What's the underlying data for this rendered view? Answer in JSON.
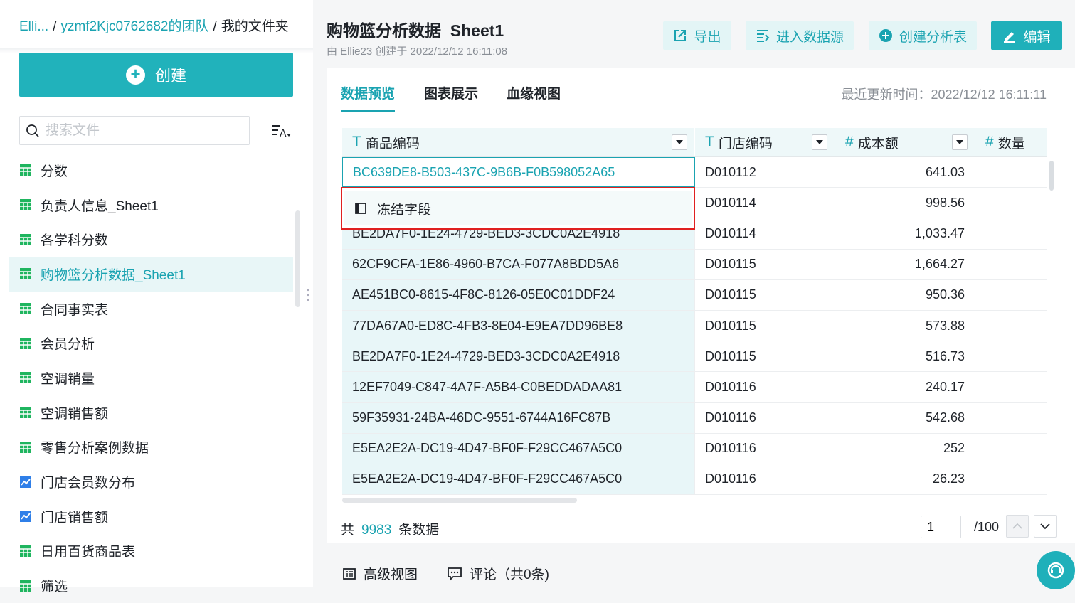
{
  "breadcrumb": {
    "item1": "Elli...",
    "item2": "yzmf2Kjc0762682的团队",
    "item3": "我的文件夹",
    "sep": "/"
  },
  "sidebar": {
    "create_label": "创建",
    "search_placeholder": "搜索文件",
    "files": [
      {
        "label": "分数",
        "icon": "table-icon",
        "active": false
      },
      {
        "label": "负责人信息_Sheet1",
        "icon": "table-icon",
        "active": false
      },
      {
        "label": "各学科分数",
        "icon": "table-icon",
        "active": false
      },
      {
        "label": "购物篮分析数据_Sheet1",
        "icon": "table-icon",
        "active": true
      },
      {
        "label": "合同事实表",
        "icon": "table-icon",
        "active": false
      },
      {
        "label": "会员分析",
        "icon": "table-icon",
        "active": false
      },
      {
        "label": "空调销量",
        "icon": "table-icon",
        "active": false
      },
      {
        "label": "空调销售额",
        "icon": "table-icon",
        "active": false
      },
      {
        "label": "零售分析案例数据",
        "icon": "table-icon",
        "active": false
      },
      {
        "label": "门店会员数分布",
        "icon": "chart-icon",
        "active": false
      },
      {
        "label": "门店销售额",
        "icon": "chart-icon",
        "active": false
      },
      {
        "label": "日用百货商品表",
        "icon": "table-icon",
        "active": false
      },
      {
        "label": "筛选",
        "icon": "table-icon",
        "active": false
      }
    ]
  },
  "header": {
    "title": "购物篮分析数据_Sheet1",
    "subtitle": "由 Ellie23 创建于 2022/12/12 16:11:08",
    "export_label": "导出",
    "datasource_label": "进入数据源",
    "create_analysis_label": "创建分析表",
    "edit_label": "编辑"
  },
  "tabs": {
    "preview": "数据预览",
    "chart": "图表展示",
    "lineage": "血缘视图",
    "updated": "最近更新时间：2022/12/12 16:11:11"
  },
  "table": {
    "columns": [
      {
        "type": "T",
        "name": "商品编码"
      },
      {
        "type": "T",
        "name": "门店编码"
      },
      {
        "type": "#",
        "name": "成本额"
      },
      {
        "type": "#",
        "name": "数量"
      }
    ],
    "rows": [
      [
        "BC639DE8-B503-437C-9B6B-F0B598052A65",
        "D010112",
        "641.03",
        ""
      ],
      [
        "",
        "D010114",
        "998.56",
        ""
      ],
      [
        "BE2DA7F0-1E24-4729-BED3-3CDC0A2E4918",
        "D010114",
        "1,033.47",
        ""
      ],
      [
        "62CF9CFA-1E86-4960-B7CA-F077A8BDD5A6",
        "D010115",
        "1,664.27",
        ""
      ],
      [
        "AE451BC0-8615-4F8C-8126-05E0C01DDF24",
        "D010115",
        "950.36",
        ""
      ],
      [
        "77DA67A0-ED8C-4FB3-8E04-E9EA7DD96BE8",
        "D010115",
        "573.88",
        ""
      ],
      [
        "BE2DA7F0-1E24-4729-BED3-3CDC0A2E4918",
        "D010115",
        "516.73",
        ""
      ],
      [
        "12EF7049-C847-4A7F-A5B4-C0BEDDADAA81",
        "D010116",
        "240.17",
        ""
      ],
      [
        "59F35931-24BA-46DC-9551-6744A16FC87B",
        "D010116",
        "542.68",
        ""
      ],
      [
        "E5EA2E2A-DC19-4D47-BF0F-F29CC467A5C0",
        "D010116",
        "252",
        ""
      ],
      [
        "E5EA2E2A-DC19-4D47-BF0F-F29CC467A5C0",
        "D010116",
        "26.23",
        ""
      ]
    ]
  },
  "context_menu": {
    "freeze_label": "冻结字段"
  },
  "footer": {
    "total_prefix": "共",
    "total_count": "9983",
    "total_suffix": "条数据",
    "page_value": "1",
    "page_total": "/100"
  },
  "bottom": {
    "advanced_view": "高级视图",
    "comments": "评论（共0条)"
  },
  "colors": {
    "accent": "#1fb0ba",
    "highlight_border": "#e02020"
  }
}
